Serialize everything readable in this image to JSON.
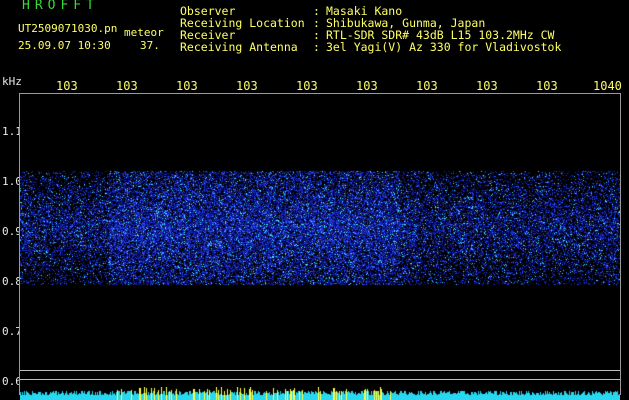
{
  "header": {
    "app_title": "HROFFT",
    "file_name": "UT2509071030.pn",
    "tag": "meteor",
    "date_time": "25.09.07 10:30",
    "count": "37."
  },
  "metadata": [
    {
      "label": "Observer",
      "value": "Masaki Kano"
    },
    {
      "label": "Receiving Location",
      "value": "Shibukawa, Gunma, Japan"
    },
    {
      "label": "Receiver",
      "value": "RTL-SDR SDR# 43dB L15 103.2MHz CW"
    },
    {
      "label": "Receiving Antenna",
      "value": "3el Yagi(V) Az 330 for Vladivostok"
    }
  ],
  "colon": ":",
  "axes": {
    "y_unit": "kHz",
    "y_ticks": [
      "1.1",
      "1.0",
      "0.9",
      "0.8",
      "0.7",
      "0.6"
    ],
    "x_ticks": [
      "103",
      "103",
      "103",
      "103",
      "103",
      "103",
      "103",
      "103",
      "103",
      "1040"
    ]
  },
  "colors": {
    "text_yellow": "#ffff66",
    "title_green": "#33dd33",
    "signal_blue": "#1a2bd8",
    "signal_cyan": "#38e0ff",
    "axis_gray": "#9a9a9a"
  }
}
